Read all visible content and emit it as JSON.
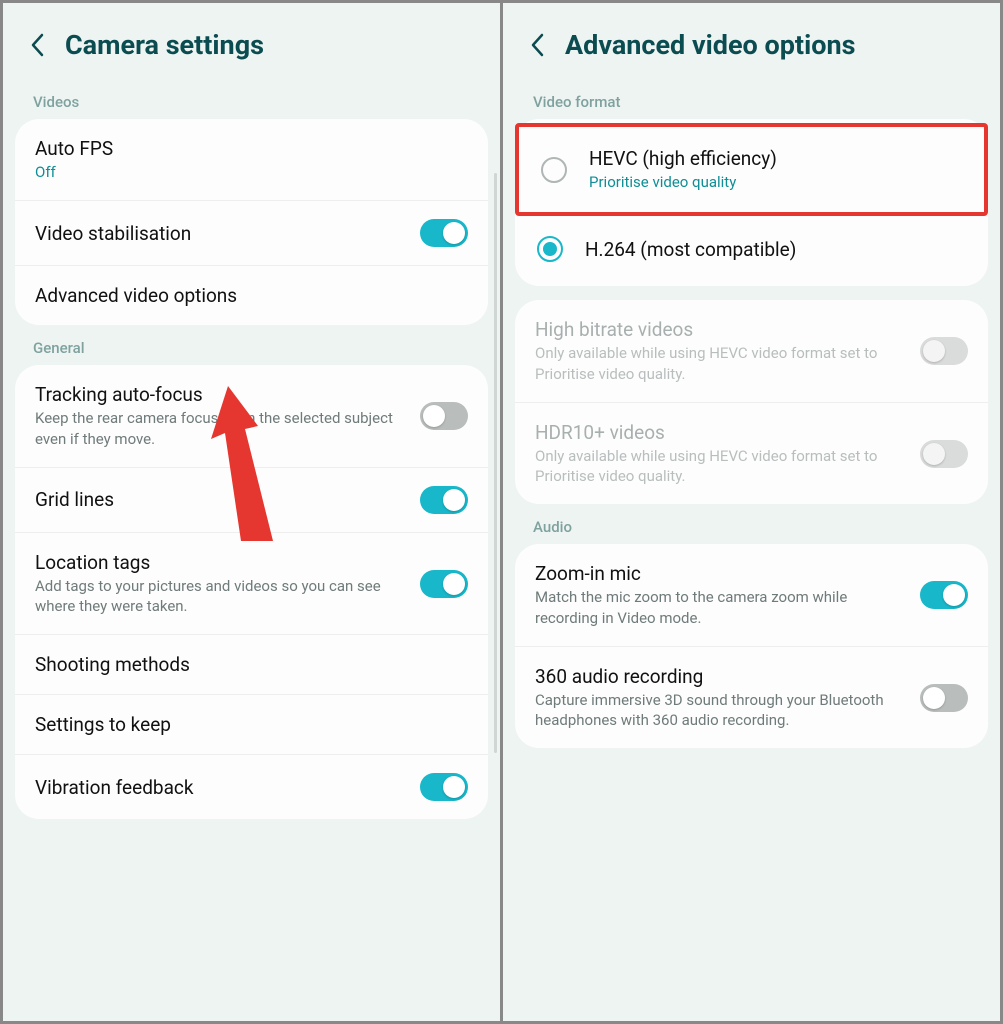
{
  "left": {
    "title": "Camera settings",
    "sections": {
      "videos_label": "Videos",
      "general_label": "General"
    },
    "auto_fps": {
      "title": "Auto FPS",
      "value": "Off"
    },
    "video_stabilisation": {
      "title": "Video stabilisation"
    },
    "advanced_video_options": {
      "title": "Advanced video options"
    },
    "tracking_autofocus": {
      "title": "Tracking auto-focus",
      "desc": "Keep the rear camera focused on the selected subject even if they move."
    },
    "grid_lines": {
      "title": "Grid lines"
    },
    "location_tags": {
      "title": "Location tags",
      "desc": "Add tags to your pictures and videos so you can see where they were taken."
    },
    "shooting_methods": {
      "title": "Shooting methods"
    },
    "settings_to_keep": {
      "title": "Settings to keep"
    },
    "vibration_feedback": {
      "title": "Vibration feedback"
    }
  },
  "right": {
    "title": "Advanced video options",
    "video_format_label": "Video format",
    "hevc": {
      "title": "HEVC (high efficiency)",
      "sub": "Prioritise video quality"
    },
    "h264": {
      "title": "H.264 (most compatible)"
    },
    "high_bitrate": {
      "title": "High bitrate videos",
      "desc": "Only available while using HEVC video format set to Prioritise video quality."
    },
    "hdr10": {
      "title": "HDR10+ videos",
      "desc": "Only available while using HEVC video format set to Prioritise video quality."
    },
    "audio_label": "Audio",
    "zoom_mic": {
      "title": "Zoom-in mic",
      "desc": "Match the mic zoom to the camera zoom while recording in Video mode."
    },
    "audio_360": {
      "title": "360 audio recording",
      "desc": "Capture immersive 3D sound through your Bluetooth headphones with 360 audio recording."
    }
  }
}
